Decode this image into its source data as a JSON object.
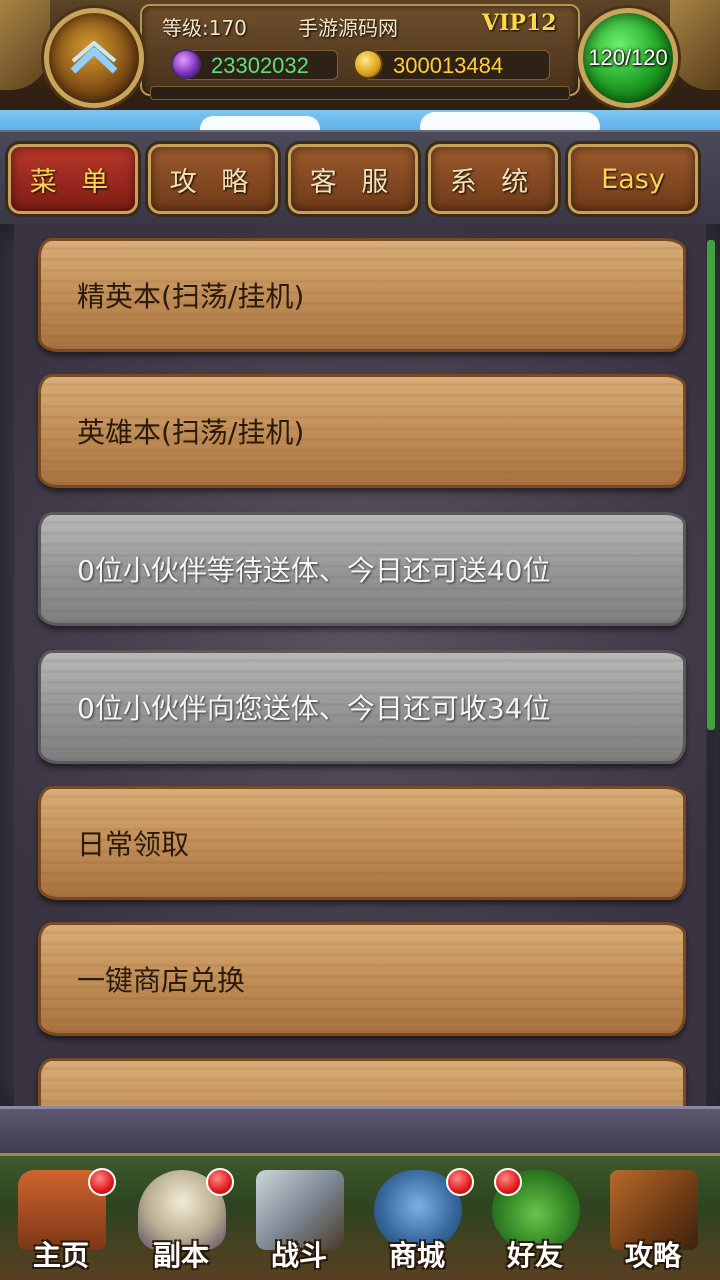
{
  "hud": {
    "level_text": "等级:170",
    "server_name": "手游源码网",
    "vip_text": "VIP12",
    "gems": "23302032",
    "coins": "300013484",
    "energy": "120/120"
  },
  "tabs": [
    {
      "label": "菜 单",
      "style": "active-red"
    },
    {
      "label": "攻 略",
      "style": "brown"
    },
    {
      "label": "客 服",
      "style": "brown"
    },
    {
      "label": "系 统",
      "style": "brown"
    },
    {
      "label": "Easy",
      "style": "brown"
    }
  ],
  "menu_items": [
    {
      "label": "精英本(扫荡/挂机)",
      "style": "wood"
    },
    {
      "label": "英雄本(扫荡/挂机)",
      "style": "wood"
    },
    {
      "label": "0位小伙伴等待送体、今日还可送40位",
      "style": "stone"
    },
    {
      "label": "0位小伙伴向您送体、今日还可收34位",
      "style": "stone"
    },
    {
      "label": "日常领取",
      "style": "wood"
    },
    {
      "label": "一键商店兑换",
      "style": "wood"
    },
    {
      "label": "",
      "style": "wood"
    }
  ],
  "bottom_nav": [
    {
      "label": "主页",
      "icon": "house-icon",
      "badge": true
    },
    {
      "label": "副本",
      "icon": "skull-icon",
      "badge": true
    },
    {
      "label": "战斗",
      "icon": "sword-icon",
      "badge": false
    },
    {
      "label": "商城",
      "icon": "monster-icon",
      "badge": true
    },
    {
      "label": "好友",
      "icon": "friend-icon",
      "badge": true
    },
    {
      "label": "攻略",
      "icon": "book-icon",
      "badge": false
    }
  ],
  "colors": {
    "gem_text": "#5de07a",
    "coin_text": "#ffcf33",
    "vip_text": "#ffd84a",
    "active_tab": "#b8362a",
    "energy_orb": "#1f9e22"
  }
}
